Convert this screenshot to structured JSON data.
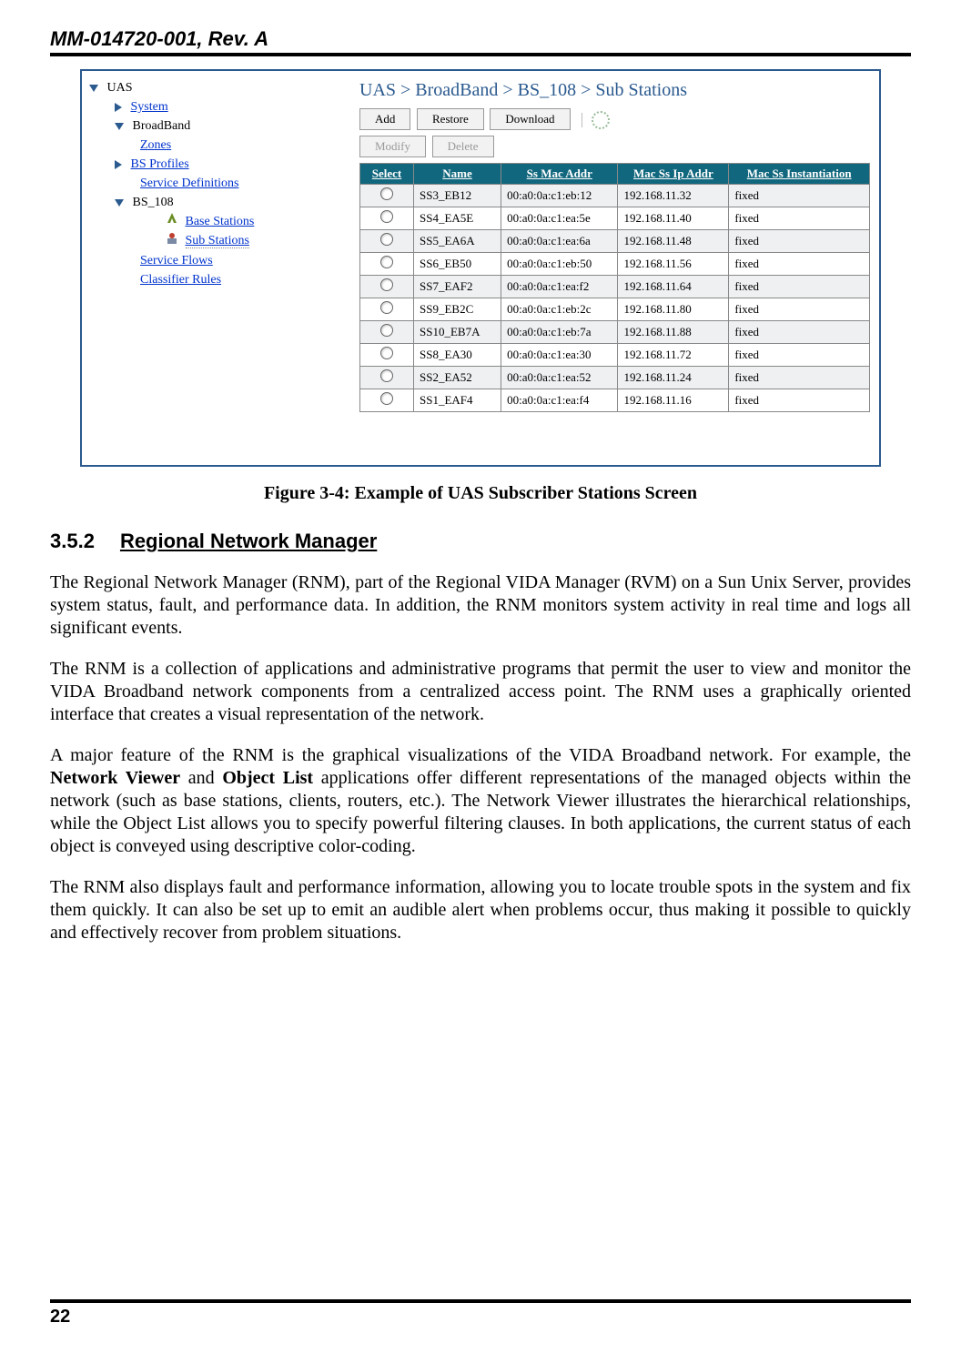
{
  "doc_header": "MM-014720-001, Rev. A",
  "tree": {
    "root": "UAS",
    "system": "System",
    "broadband": "BroadBand",
    "zones": "Zones",
    "bsprofiles": "BS Profiles",
    "servicedefs": "Service Definitions",
    "bs108": "BS_108",
    "basestations": "Base Stations",
    "substations": "Sub Stations",
    "serviceflows": "Service Flows",
    "classrules": "Classifier Rules"
  },
  "breadcrumb": "UAS > BroadBand > BS_108 > Sub Stations",
  "buttons": {
    "add": "Add",
    "restore": "Restore",
    "download": "Download",
    "modify": "Modify",
    "delete": "Delete"
  },
  "columns": {
    "select": "Select",
    "name": "Name",
    "mac": "Ss Mac Addr",
    "ip": "Mac Ss Ip Addr",
    "inst": "Mac Ss Instantiation"
  },
  "rows": [
    {
      "name": "SS3_EB12",
      "mac": "00:a0:0a:c1:eb:12",
      "ip": "192.168.11.32",
      "inst": "fixed"
    },
    {
      "name": "SS4_EA5E",
      "mac": "00:a0:0a:c1:ea:5e",
      "ip": "192.168.11.40",
      "inst": "fixed"
    },
    {
      "name": "SS5_EA6A",
      "mac": "00:a0:0a:c1:ea:6a",
      "ip": "192.168.11.48",
      "inst": "fixed"
    },
    {
      "name": "SS6_EB50",
      "mac": "00:a0:0a:c1:eb:50",
      "ip": "192.168.11.56",
      "inst": "fixed"
    },
    {
      "name": "SS7_EAF2",
      "mac": "00:a0:0a:c1:ea:f2",
      "ip": "192.168.11.64",
      "inst": "fixed"
    },
    {
      "name": "SS9_EB2C",
      "mac": "00:a0:0a:c1:eb:2c",
      "ip": "192.168.11.80",
      "inst": "fixed"
    },
    {
      "name": "SS10_EB7A",
      "mac": "00:a0:0a:c1:eb:7a",
      "ip": "192.168.11.88",
      "inst": "fixed"
    },
    {
      "name": "SS8_EA30",
      "mac": "00:a0:0a:c1:ea:30",
      "ip": "192.168.11.72",
      "inst": "fixed"
    },
    {
      "name": "SS2_EA52",
      "mac": "00:a0:0a:c1:ea:52",
      "ip": "192.168.11.24",
      "inst": "fixed"
    },
    {
      "name": "SS1_EAF4",
      "mac": "00:a0:0a:c1:ea:f4",
      "ip": "192.168.11.16",
      "inst": "fixed"
    }
  ],
  "figure_caption": "Figure 3-4:  Example of UAS Subscriber Stations Screen",
  "section": {
    "num": "3.5.2",
    "title": "Regional Network Manager"
  },
  "paragraphs": {
    "p1": "The Regional Network Manager (RNM), part of the Regional VIDA Manager (RVM) on a Sun Unix Server, provides system status, fault, and performance data.  In addition, the RNM monitors system activity in real time and logs all significant events.",
    "p2": "The RNM is a collection of applications and administrative programs that permit the user to view and monitor the VIDA Broadband network components from a centralized access point.  The RNM uses a graphically oriented interface that creates a visual representation of the network.",
    "p3a": "A major feature of the RNM is the graphical visualizations of the VIDA Broadband network.  For example, the ",
    "p3b": "Network Viewer",
    "p3c": " and ",
    "p3d": "Object List",
    "p3e": " applications offer different representations of the managed objects within the network (such as base stations, clients, routers, etc.).  The Network Viewer illustrates the hierarchical relationships, while the Object List allows you to specify powerful filtering clauses.  In both applications, the current status of each object is conveyed using descriptive color-coding.",
    "p4": "The RNM also displays fault and performance information, allowing you to locate trouble spots in the system and fix them quickly.  It can also be set up to emit an audible alert when problems occur, thus making it possible to quickly and effectively recover from problem situations."
  },
  "page_number": "22"
}
